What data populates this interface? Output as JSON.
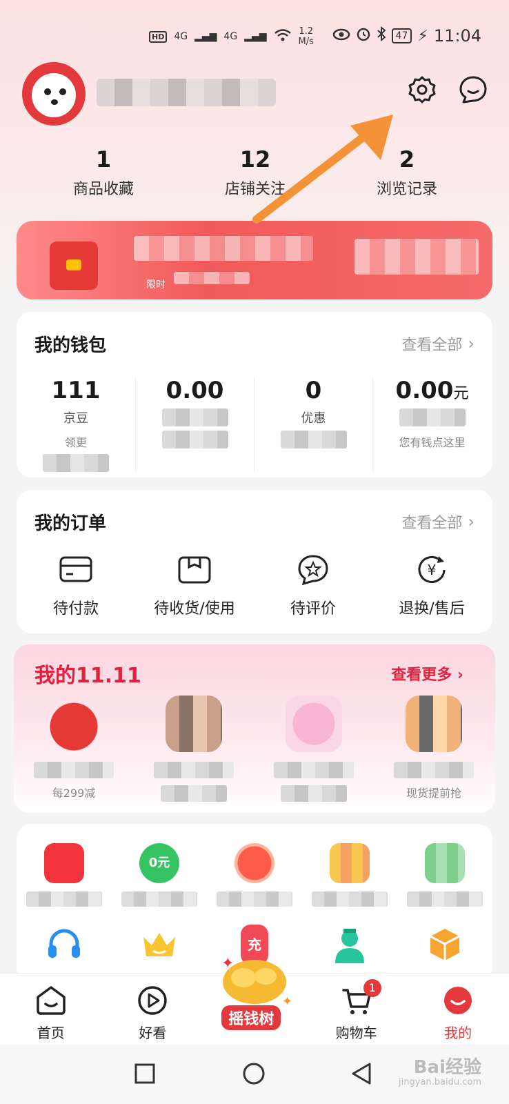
{
  "status_bar": {
    "network_hd": "HD",
    "signal_1": "4G",
    "signal_2": "4G",
    "speed_value": "1.2",
    "speed_unit": "M/s",
    "battery": "47",
    "time": "11:04"
  },
  "header": {
    "avatar": "jd-mascot-avatar",
    "settings_icon": "gear-icon",
    "message_icon": "message-bubble-icon"
  },
  "stats": [
    {
      "value": "1",
      "label": "商品收藏"
    },
    {
      "value": "12",
      "label": "店铺关注"
    },
    {
      "value": "2",
      "label": "浏览记录"
    }
  ],
  "promo": {
    "small_text": "限时"
  },
  "wallet": {
    "title": "我的钱包",
    "more": "查看全部",
    "items": [
      {
        "value": "111",
        "unit": "",
        "label": "京豆",
        "sub": "领更"
      },
      {
        "value": "0.00",
        "unit": "",
        "label": "",
        "sub": ""
      },
      {
        "value": "0",
        "unit": "",
        "label": "优惠",
        "sub": ""
      },
      {
        "value": "0.00",
        "unit": "元",
        "label": "",
        "sub": "您有钱点这里"
      }
    ]
  },
  "orders": {
    "title": "我的订单",
    "more": "查看全部",
    "items": [
      {
        "label": "待付款",
        "icon": "wallet-card-icon"
      },
      {
        "label": "待收货/使用",
        "icon": "package-box-icon"
      },
      {
        "label": "待评价",
        "icon": "star-comment-icon"
      },
      {
        "label": "退换/售后",
        "icon": "refund-yuan-icon"
      }
    ]
  },
  "double11": {
    "title": "我的11.11",
    "more": "查看更多",
    "items": [
      {
        "sub": "每299减"
      },
      {
        "sub": ""
      },
      {
        "sub": ""
      },
      {
        "sub": "现货提前抢"
      }
    ]
  },
  "services": {
    "row1_icons": [
      "red-envelope-icon",
      "green-tree-icon",
      "alarm-clock-icon",
      "gift-box-icon",
      "green-phone-icon"
    ],
    "row1_text": "0元",
    "row2_icons": [
      "headset-icon",
      "crown-icon",
      "recharge-phone-icon",
      "doctor-icon",
      "cube-icon"
    ],
    "row2_text": "充"
  },
  "tabbar": {
    "items": [
      {
        "label": "首页",
        "icon": "home-smile-icon"
      },
      {
        "label": "好看",
        "icon": "play-video-icon"
      },
      {
        "label": "摇钱树",
        "icon": "money-tree-icon"
      },
      {
        "label": "购物车",
        "icon": "cart-icon",
        "badge": "1"
      },
      {
        "label": "我的",
        "icon": "me-smile-icon"
      }
    ]
  },
  "watermark": {
    "main": "Bai经验",
    "sub": "jingyan.baidu.com"
  },
  "colors": {
    "accent": "#e4393c",
    "d11": "#e0223c",
    "arrow": "#f39236"
  }
}
